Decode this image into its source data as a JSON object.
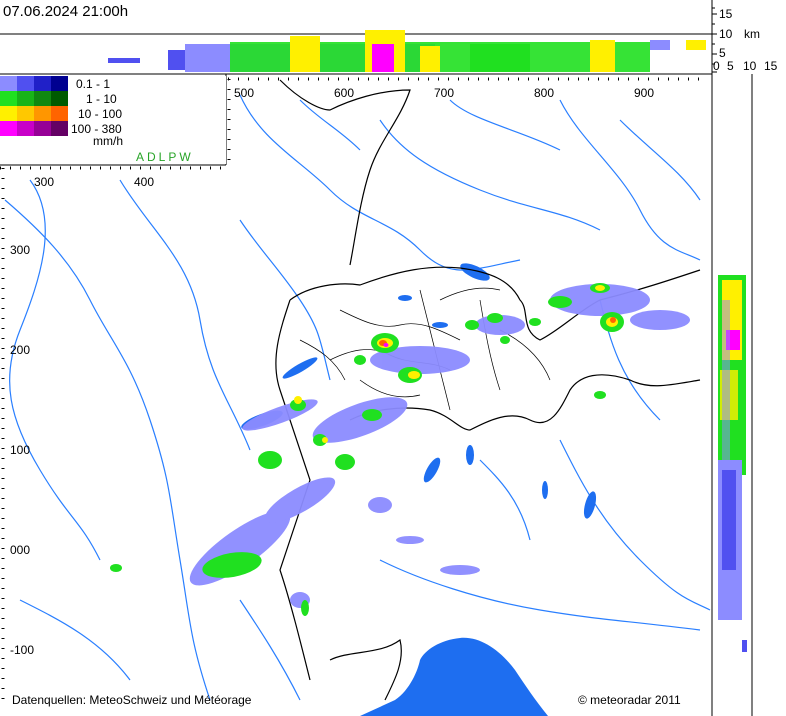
{
  "header": {
    "timestamp": "07.06.2024 21:00h"
  },
  "legend": {
    "unit": "mm/h",
    "network": "ADLPW",
    "classes": [
      {
        "label": "0.1 -    1",
        "colors": [
          "#8c8cff",
          "#5050f0",
          "#2020c8",
          "#000090"
        ]
      },
      {
        "label": "1 -   10",
        "colors": [
          "#20e020",
          "#18b418",
          "#108810",
          "#005a00"
        ]
      },
      {
        "label": "10 - 100",
        "colors": [
          "#fff000",
          "#ffc800",
          "#ff9600",
          "#ff6400"
        ]
      },
      {
        "label": "100 - 380",
        "colors": [
          "#ff00ff",
          "#c800c8",
          "#960096",
          "#640064"
        ]
      }
    ]
  },
  "axes": {
    "x_ticks_top": [
      "500",
      "600",
      "700",
      "800",
      "900"
    ],
    "x_ticks_main": [
      "300",
      "400"
    ],
    "y_ticks": [
      "300",
      "200",
      "100",
      "000",
      "-100"
    ],
    "height_ticks": [
      "15",
      "10",
      "5",
      "0"
    ],
    "height_unit": "km",
    "side_ticks": [
      "0",
      "5",
      "10",
      "15"
    ]
  },
  "footer": {
    "sources": "Datenquellen: MeteoSchweiz und Météorage",
    "copyright": "© meteoradar 2011"
  },
  "colors": {
    "water": "#2a7fff",
    "lake": "#1e6ef0",
    "border": "#000000",
    "rain_light": "#8c8cff",
    "rain_medium": "#20e020",
    "rain_heavy": "#fff000",
    "rain_extreme": "#ff00ff"
  }
}
